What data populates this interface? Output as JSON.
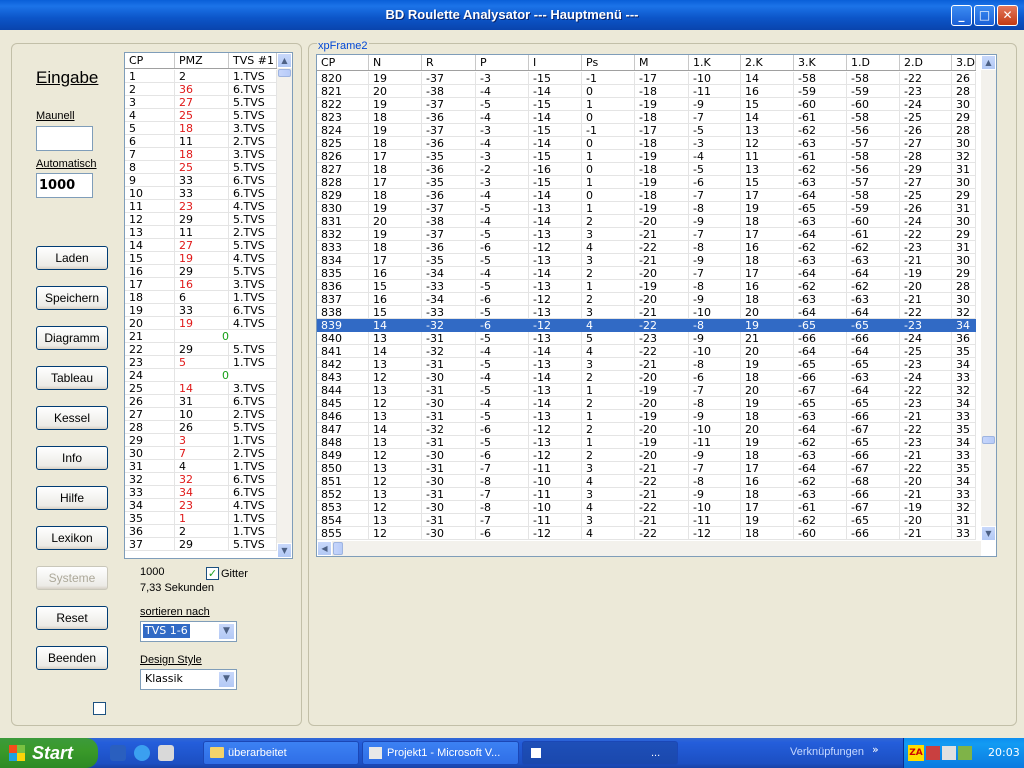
{
  "window": {
    "title": "BD Roulette Analysator ---  Hauptmenü ---"
  },
  "left": {
    "eingabe_label": "Eingabe",
    "manuell_label": "Maunell",
    "manuell_value": "",
    "auto_label": "Automatisch",
    "auto_value": "1000",
    "buttons": [
      {
        "label": "Laden",
        "enabled": true
      },
      {
        "label": "Speichern",
        "enabled": true
      },
      {
        "label": "Diagramm",
        "enabled": true
      },
      {
        "label": "Tableau",
        "enabled": true
      },
      {
        "label": "Kessel",
        "enabled": true
      },
      {
        "label": "Info",
        "enabled": true
      },
      {
        "label": "Hilfe",
        "enabled": true
      },
      {
        "label": "Lexikon",
        "enabled": true
      },
      {
        "label": "Systeme",
        "enabled": false
      },
      {
        "label": "Reset",
        "enabled": true
      },
      {
        "label": "Beenden",
        "enabled": true
      }
    ]
  },
  "small_grid": {
    "headers": [
      "CP",
      "PMZ",
      "TVS #1"
    ],
    "rows": [
      [
        "1",
        "2",
        "1.TVS",
        "black"
      ],
      [
        "2",
        "36",
        "6.TVS",
        "red"
      ],
      [
        "3",
        "27",
        "5.TVS",
        "red"
      ],
      [
        "4",
        "25",
        "5.TVS",
        "red"
      ],
      [
        "5",
        "18",
        "3.TVS",
        "red"
      ],
      [
        "6",
        "11",
        "2.TVS",
        "black"
      ],
      [
        "7",
        "18",
        "3.TVS",
        "red"
      ],
      [
        "8",
        "25",
        "5.TVS",
        "red"
      ],
      [
        "9",
        "33",
        "6.TVS",
        "black"
      ],
      [
        "10",
        "33",
        "6.TVS",
        "black"
      ],
      [
        "11",
        "23",
        "4.TVS",
        "red"
      ],
      [
        "12",
        "29",
        "5.TVS",
        "black"
      ],
      [
        "13",
        "11",
        "2.TVS",
        "black"
      ],
      [
        "14",
        "27",
        "5.TVS",
        "red"
      ],
      [
        "15",
        "19",
        "4.TVS",
        "red"
      ],
      [
        "16",
        "29",
        "5.TVS",
        "black"
      ],
      [
        "17",
        "16",
        "3.TVS",
        "red"
      ],
      [
        "18",
        "6",
        "1.TVS",
        "black"
      ],
      [
        "19",
        "33",
        "6.TVS",
        "black"
      ],
      [
        "20",
        "19",
        "4.TVS",
        "red"
      ],
      [
        "21",
        "0",
        "",
        "green"
      ],
      [
        "22",
        "29",
        "5.TVS",
        "black"
      ],
      [
        "23",
        "5",
        "1.TVS",
        "red"
      ],
      [
        "24",
        "0",
        "",
        "green"
      ],
      [
        "25",
        "14",
        "3.TVS",
        "red"
      ],
      [
        "26",
        "31",
        "6.TVS",
        "black"
      ],
      [
        "27",
        "10",
        "2.TVS",
        "black"
      ],
      [
        "28",
        "26",
        "5.TVS",
        "black"
      ],
      [
        "29",
        "3",
        "1.TVS",
        "red"
      ],
      [
        "30",
        "7",
        "2.TVS",
        "red"
      ],
      [
        "31",
        "4",
        "1.TVS",
        "black"
      ],
      [
        "32",
        "32",
        "6.TVS",
        "red"
      ],
      [
        "33",
        "34",
        "6.TVS",
        "red"
      ],
      [
        "34",
        "23",
        "4.TVS",
        "red"
      ],
      [
        "35",
        "1",
        "1.TVS",
        "red"
      ],
      [
        "36",
        "2",
        "1.TVS",
        "black"
      ],
      [
        "37",
        "29",
        "5.TVS",
        "black"
      ]
    ]
  },
  "stats": {
    "count": "1000",
    "time": "7,33 Sekunden",
    "gitter_label": "Gitter",
    "gitter_checked": true
  },
  "sort": {
    "label": "sortieren nach",
    "value": "TVS 1-6"
  },
  "design": {
    "label": "Design Style",
    "value": "Klassik"
  },
  "frame_label": "xpFrame2",
  "big_grid": {
    "headers": [
      "CP",
      "N",
      "R",
      "P",
      "I",
      "Ps",
      "M",
      "1.K",
      "2.K",
      "3.K",
      "1.D",
      "2.D",
      "3.D"
    ],
    "selected_row": 19,
    "rows": [
      [
        "820",
        "19",
        "-37",
        "-3",
        "-15",
        "-1",
        "-17",
        "-10",
        "14",
        "-58",
        "-58",
        "-22",
        "26"
      ],
      [
        "821",
        "20",
        "-38",
        "-4",
        "-14",
        "0",
        "-18",
        "-11",
        "16",
        "-59",
        "-59",
        "-23",
        "28"
      ],
      [
        "822",
        "19",
        "-37",
        "-5",
        "-15",
        "1",
        "-19",
        "-9",
        "15",
        "-60",
        "-60",
        "-24",
        "30"
      ],
      [
        "823",
        "18",
        "-36",
        "-4",
        "-14",
        "0",
        "-18",
        "-7",
        "14",
        "-61",
        "-58",
        "-25",
        "29"
      ],
      [
        "824",
        "19",
        "-37",
        "-3",
        "-15",
        "-1",
        "-17",
        "-5",
        "13",
        "-62",
        "-56",
        "-26",
        "28"
      ],
      [
        "825",
        "18",
        "-36",
        "-4",
        "-14",
        "0",
        "-18",
        "-3",
        "12",
        "-63",
        "-57",
        "-27",
        "30"
      ],
      [
        "826",
        "17",
        "-35",
        "-3",
        "-15",
        "1",
        "-19",
        "-4",
        "11",
        "-61",
        "-58",
        "-28",
        "32"
      ],
      [
        "827",
        "18",
        "-36",
        "-2",
        "-16",
        "0",
        "-18",
        "-5",
        "13",
        "-62",
        "-56",
        "-29",
        "31"
      ],
      [
        "828",
        "17",
        "-35",
        "-3",
        "-15",
        "1",
        "-19",
        "-6",
        "15",
        "-63",
        "-57",
        "-27",
        "30"
      ],
      [
        "829",
        "18",
        "-36",
        "-4",
        "-14",
        "0",
        "-18",
        "-7",
        "17",
        "-64",
        "-58",
        "-25",
        "29"
      ],
      [
        "830",
        "19",
        "-37",
        "-5",
        "-13",
        "1",
        "-19",
        "-8",
        "19",
        "-65",
        "-59",
        "-26",
        "31"
      ],
      [
        "831",
        "20",
        "-38",
        "-4",
        "-14",
        "2",
        "-20",
        "-9",
        "18",
        "-63",
        "-60",
        "-24",
        "30"
      ],
      [
        "832",
        "19",
        "-37",
        "-5",
        "-13",
        "3",
        "-21",
        "-7",
        "17",
        "-64",
        "-61",
        "-22",
        "29"
      ],
      [
        "833",
        "18",
        "-36",
        "-6",
        "-12",
        "4",
        "-22",
        "-8",
        "16",
        "-62",
        "-62",
        "-23",
        "31"
      ],
      [
        "834",
        "17",
        "-35",
        "-5",
        "-13",
        "3",
        "-21",
        "-9",
        "18",
        "-63",
        "-63",
        "-21",
        "30"
      ],
      [
        "835",
        "16",
        "-34",
        "-4",
        "-14",
        "2",
        "-20",
        "-7",
        "17",
        "-64",
        "-64",
        "-19",
        "29"
      ],
      [
        "836",
        "15",
        "-33",
        "-5",
        "-13",
        "1",
        "-19",
        "-8",
        "16",
        "-62",
        "-62",
        "-20",
        "28"
      ],
      [
        "837",
        "16",
        "-34",
        "-6",
        "-12",
        "2",
        "-20",
        "-9",
        "18",
        "-63",
        "-63",
        "-21",
        "30"
      ],
      [
        "838",
        "15",
        "-33",
        "-5",
        "-13",
        "3",
        "-21",
        "-10",
        "20",
        "-64",
        "-64",
        "-22",
        "32"
      ],
      [
        "839",
        "14",
        "-32",
        "-6",
        "-12",
        "4",
        "-22",
        "-8",
        "19",
        "-65",
        "-65",
        "-23",
        "34"
      ],
      [
        "840",
        "13",
        "-31",
        "-5",
        "-13",
        "5",
        "-23",
        "-9",
        "21",
        "-66",
        "-66",
        "-24",
        "36"
      ],
      [
        "841",
        "14",
        "-32",
        "-4",
        "-14",
        "4",
        "-22",
        "-10",
        "20",
        "-64",
        "-64",
        "-25",
        "35"
      ],
      [
        "842",
        "13",
        "-31",
        "-5",
        "-13",
        "3",
        "-21",
        "-8",
        "19",
        "-65",
        "-65",
        "-23",
        "34"
      ],
      [
        "843",
        "12",
        "-30",
        "-4",
        "-14",
        "2",
        "-20",
        "-6",
        "18",
        "-66",
        "-63",
        "-24",
        "33"
      ],
      [
        "844",
        "13",
        "-31",
        "-5",
        "-13",
        "1",
        "-19",
        "-7",
        "20",
        "-67",
        "-64",
        "-22",
        "32"
      ],
      [
        "845",
        "12",
        "-30",
        "-4",
        "-14",
        "2",
        "-20",
        "-8",
        "19",
        "-65",
        "-65",
        "-23",
        "34"
      ],
      [
        "846",
        "13",
        "-31",
        "-5",
        "-13",
        "1",
        "-19",
        "-9",
        "18",
        "-63",
        "-66",
        "-21",
        "33"
      ],
      [
        "847",
        "14",
        "-32",
        "-6",
        "-12",
        "2",
        "-20",
        "-10",
        "20",
        "-64",
        "-67",
        "-22",
        "35"
      ],
      [
        "848",
        "13",
        "-31",
        "-5",
        "-13",
        "1",
        "-19",
        "-11",
        "19",
        "-62",
        "-65",
        "-23",
        "34"
      ],
      [
        "849",
        "12",
        "-30",
        "-6",
        "-12",
        "2",
        "-20",
        "-9",
        "18",
        "-63",
        "-66",
        "-21",
        "33"
      ],
      [
        "850",
        "13",
        "-31",
        "-7",
        "-11",
        "3",
        "-21",
        "-7",
        "17",
        "-64",
        "-67",
        "-22",
        "35"
      ],
      [
        "851",
        "12",
        "-30",
        "-8",
        "-10",
        "4",
        "-22",
        "-8",
        "16",
        "-62",
        "-68",
        "-20",
        "34"
      ],
      [
        "852",
        "13",
        "-31",
        "-7",
        "-11",
        "3",
        "-21",
        "-9",
        "18",
        "-63",
        "-66",
        "-21",
        "33"
      ],
      [
        "853",
        "12",
        "-30",
        "-8",
        "-10",
        "4",
        "-22",
        "-10",
        "17",
        "-61",
        "-67",
        "-19",
        "32"
      ],
      [
        "854",
        "13",
        "-31",
        "-7",
        "-11",
        "3",
        "-21",
        "-11",
        "19",
        "-62",
        "-65",
        "-20",
        "31"
      ],
      [
        "855",
        "12",
        "-30",
        "-6",
        "-12",
        "4",
        "-22",
        "-12",
        "18",
        "-60",
        "-66",
        "-21",
        "33"
      ]
    ]
  },
  "taskbar": {
    "start_label": "Start",
    "tasks": [
      "überarbeitet",
      "Projekt1 - Microsoft V...",
      "..."
    ],
    "links_label": "Verknüpfungen",
    "clock": "20:03"
  }
}
